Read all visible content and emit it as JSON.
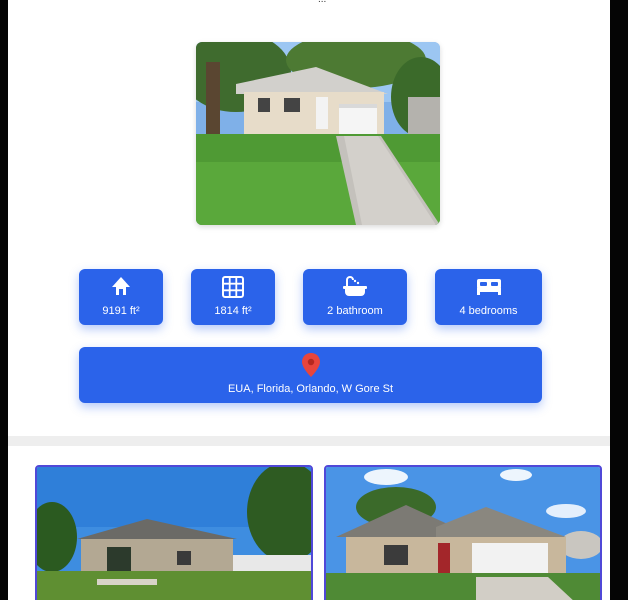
{
  "header": {
    "fragment": "..."
  },
  "property": {
    "hero_image": {
      "description_icon": "house-photo"
    },
    "stats": [
      {
        "icon": "house-icon",
        "label": "9191 ft²"
      },
      {
        "icon": "grid-icon",
        "label": "1814 ft²"
      },
      {
        "icon": "bathtub-icon",
        "label": "2 bathroom"
      },
      {
        "icon": "bed-icon",
        "label": "4 bedrooms"
      }
    ],
    "location": {
      "icon": "map-pin-icon",
      "address": "EUA, Florida, Orlando, W Gore St"
    }
  },
  "related": {
    "cards": [
      {
        "image": "house-photo"
      },
      {
        "image": "house-photo"
      }
    ]
  },
  "colors": {
    "accent": "#2b63ea",
    "pin": "#e8453c",
    "card_border": "#5048d8",
    "divider": "#eeeeee"
  }
}
